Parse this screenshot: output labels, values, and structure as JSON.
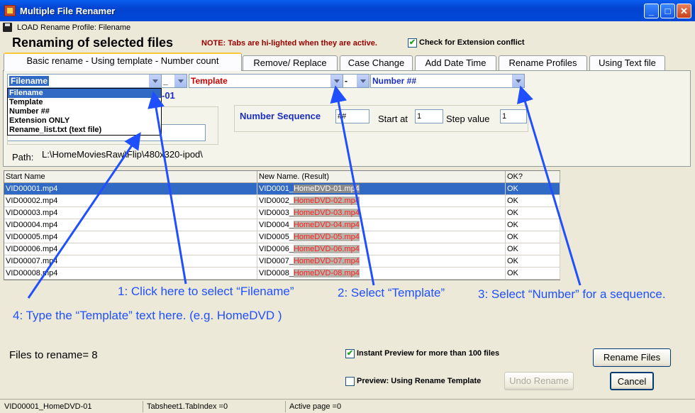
{
  "window": {
    "title": "Multiple File Renamer",
    "min_label": "_",
    "max_label": "□",
    "close_label": "✕"
  },
  "profile_bar": {
    "text": "LOAD Rename Profile: Filename"
  },
  "header": {
    "title": "Renaming of selected files",
    "note": "NOTE: Tabs are hi-lighted when they are active.",
    "ext_conflict_label": "Check for Extension conflict",
    "ext_conflict_checked": true
  },
  "tabs": [
    {
      "label": "Basic rename - Using template - Number count",
      "active": true
    },
    {
      "label": "Remove/ Replace"
    },
    {
      "label": "Case Change"
    },
    {
      "label": "Add Date Time"
    },
    {
      "label": "Rename Profiles"
    },
    {
      "label": "Using Text file"
    }
  ],
  "template_row": {
    "combo1_value": "Filename",
    "sep1_value": "_",
    "combo2_value": "Template",
    "sep2_value": "-",
    "combo3_value": "Number ##"
  },
  "dropdown_options": [
    "Filename",
    "Template",
    "Number ##",
    "Extension ONLY",
    "Rename_list.txt (text file)"
  ],
  "preview_fragment": "-01",
  "number_sequence": {
    "label": "Number Sequence",
    "value": "##",
    "start_label": "Start at",
    "start_value": "1",
    "step_label": "Step value",
    "step_value": "1"
  },
  "path": {
    "label": "Path:",
    "value": "L:\\HomeMoviesRaw\\Flip\\480x320-ipod\\"
  },
  "grid": {
    "headers": [
      "Start Name",
      "New Name. (Result)",
      "OK?"
    ],
    "rows": [
      {
        "start": "VID00001.mp4",
        "new_prefix": "VID0001_",
        "new_suffix": "HomeDVD-01.mp4",
        "ok": "OK"
      },
      {
        "start": "VID00002.mp4",
        "new_prefix": "VID0002_",
        "new_suffix": "HomeDVD-02.mp4",
        "ok": "OK"
      },
      {
        "start": "VID00003.mp4",
        "new_prefix": "VID0003_",
        "new_suffix": "HomeDVD-03.mp4",
        "ok": "OK"
      },
      {
        "start": "VID00004.mp4",
        "new_prefix": "VID0004_",
        "new_suffix": "HomeDVD-04.mp4",
        "ok": "OK"
      },
      {
        "start": "VID00005.mp4",
        "new_prefix": "VID0005_",
        "new_suffix": "HomeDVD-05.mp4",
        "ok": "OK"
      },
      {
        "start": "VID00006.mp4",
        "new_prefix": "VID0006_",
        "new_suffix": "HomeDVD-06.mp4",
        "ok": "OK"
      },
      {
        "start": "VID00007.mp4",
        "new_prefix": "VID0007_",
        "new_suffix": "HomeDVD-07.mp4",
        "ok": "OK"
      },
      {
        "start": "VID00008.mp4",
        "new_prefix": "VID0008_",
        "new_suffix": "HomeDVD-08.mp4",
        "ok": "OK"
      }
    ]
  },
  "annotations": {
    "a1": "1: Click here to select “Filename”",
    "a2": "2: Select “Template”",
    "a3": "3: Select “Number” for a sequence.",
    "a4": "4: Type the “Template” text here. (e.g. HomeDVD )"
  },
  "bottom": {
    "files_to_rename": "Files to rename= 8",
    "instant_preview_label": "Instant Preview for more than 100 files",
    "instant_preview_checked": true,
    "preview_template_label": "Preview: Using Rename Template",
    "preview_template_checked": false,
    "rename_button": "Rename Files",
    "undo_button": "Undo Rename",
    "cancel_button": "Cancel"
  },
  "statusbar": [
    "VID00001_HomeDVD-01",
    "Tabsheet1.TabIndex =0",
    "Active page =0"
  ],
  "colors": {
    "accent": "#316ac5",
    "annotation": "#1f4fff",
    "highlight_red": "#ff2020",
    "note": "#990000"
  }
}
